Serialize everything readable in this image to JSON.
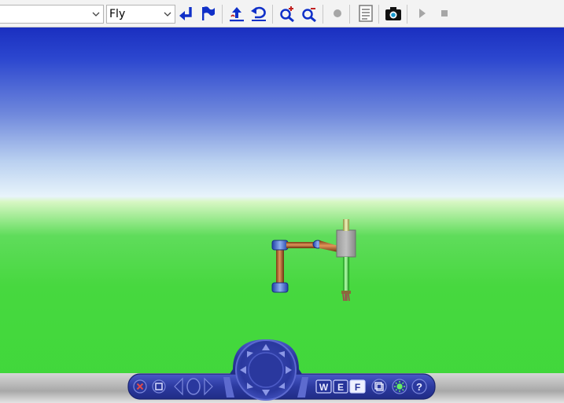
{
  "toolbar": {
    "viewpoint_value": "",
    "nav_mode_value": "Fly",
    "buttons": [
      {
        "name": "return-arrow-icon"
      },
      {
        "name": "flag-icon"
      },
      {
        "name": "straighten-icon"
      },
      {
        "name": "undo-move-icon"
      },
      {
        "name": "zoom-in-icon"
      },
      {
        "name": "zoom-out-icon"
      },
      {
        "name": "record-icon"
      },
      {
        "name": "document-icon"
      },
      {
        "name": "camera-icon"
      },
      {
        "name": "play-icon"
      },
      {
        "name": "stop-icon"
      }
    ]
  },
  "nav_panel": {
    "modes": [
      "W",
      "E",
      "F"
    ],
    "help_label": "?"
  },
  "colors": {
    "sky_top": "#1a2fc0",
    "horizon": "#e8f4fb",
    "ground": "#3fd73a",
    "nav_panel": "#3a49b5",
    "toolbar_icon": "#1030c8"
  }
}
